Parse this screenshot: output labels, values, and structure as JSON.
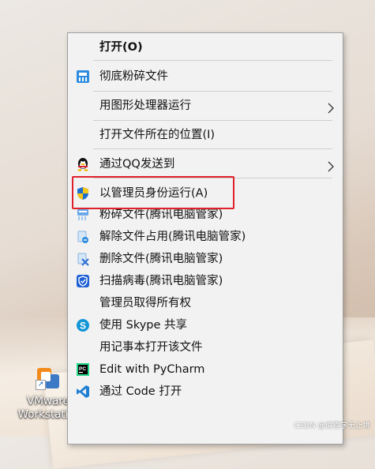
{
  "desktop": {
    "icon_label_line1": "VMware",
    "icon_label_line2": "Workstati...",
    "icon_name": "vmware-workstation-icon"
  },
  "context_menu": {
    "items": [
      {
        "label": "打开(O)",
        "bold": true
      },
      {
        "label": "彻底粉碎文件",
        "icon": "shredder-icon"
      },
      {
        "label": "用图形处理器运行",
        "submenu": true
      },
      {
        "label": "打开文件所在的位置(I)"
      },
      {
        "label": "通过QQ发送到",
        "icon": "qq-penguin-icon",
        "submenu": true
      },
      {
        "label": "以管理员身份运行(A)",
        "icon": "uac-shield-icon",
        "highlighted": true
      },
      {
        "label": "粉碎文件(腾讯电脑管家)",
        "icon": "tencent-shred-icon"
      },
      {
        "label": "解除文件占用(腾讯电脑管家)",
        "icon": "tencent-unlock-icon"
      },
      {
        "label": "删除文件(腾讯电脑管家)",
        "icon": "tencent-delete-icon"
      },
      {
        "label": "扫描病毒(腾讯电脑管家)",
        "icon": "tencent-shield-icon"
      },
      {
        "label": "管理员取得所有权"
      },
      {
        "label": "使用 Skype 共享",
        "icon": "skype-icon"
      },
      {
        "label": "用记事本打开该文件"
      },
      {
        "label": "Edit with PyCharm",
        "icon": "pycharm-icon"
      },
      {
        "label": "通过 Code 打开",
        "icon": "vscode-icon"
      }
    ]
  },
  "highlight_color": "#e0202a",
  "watermark": "CSDN @编程学无止境"
}
